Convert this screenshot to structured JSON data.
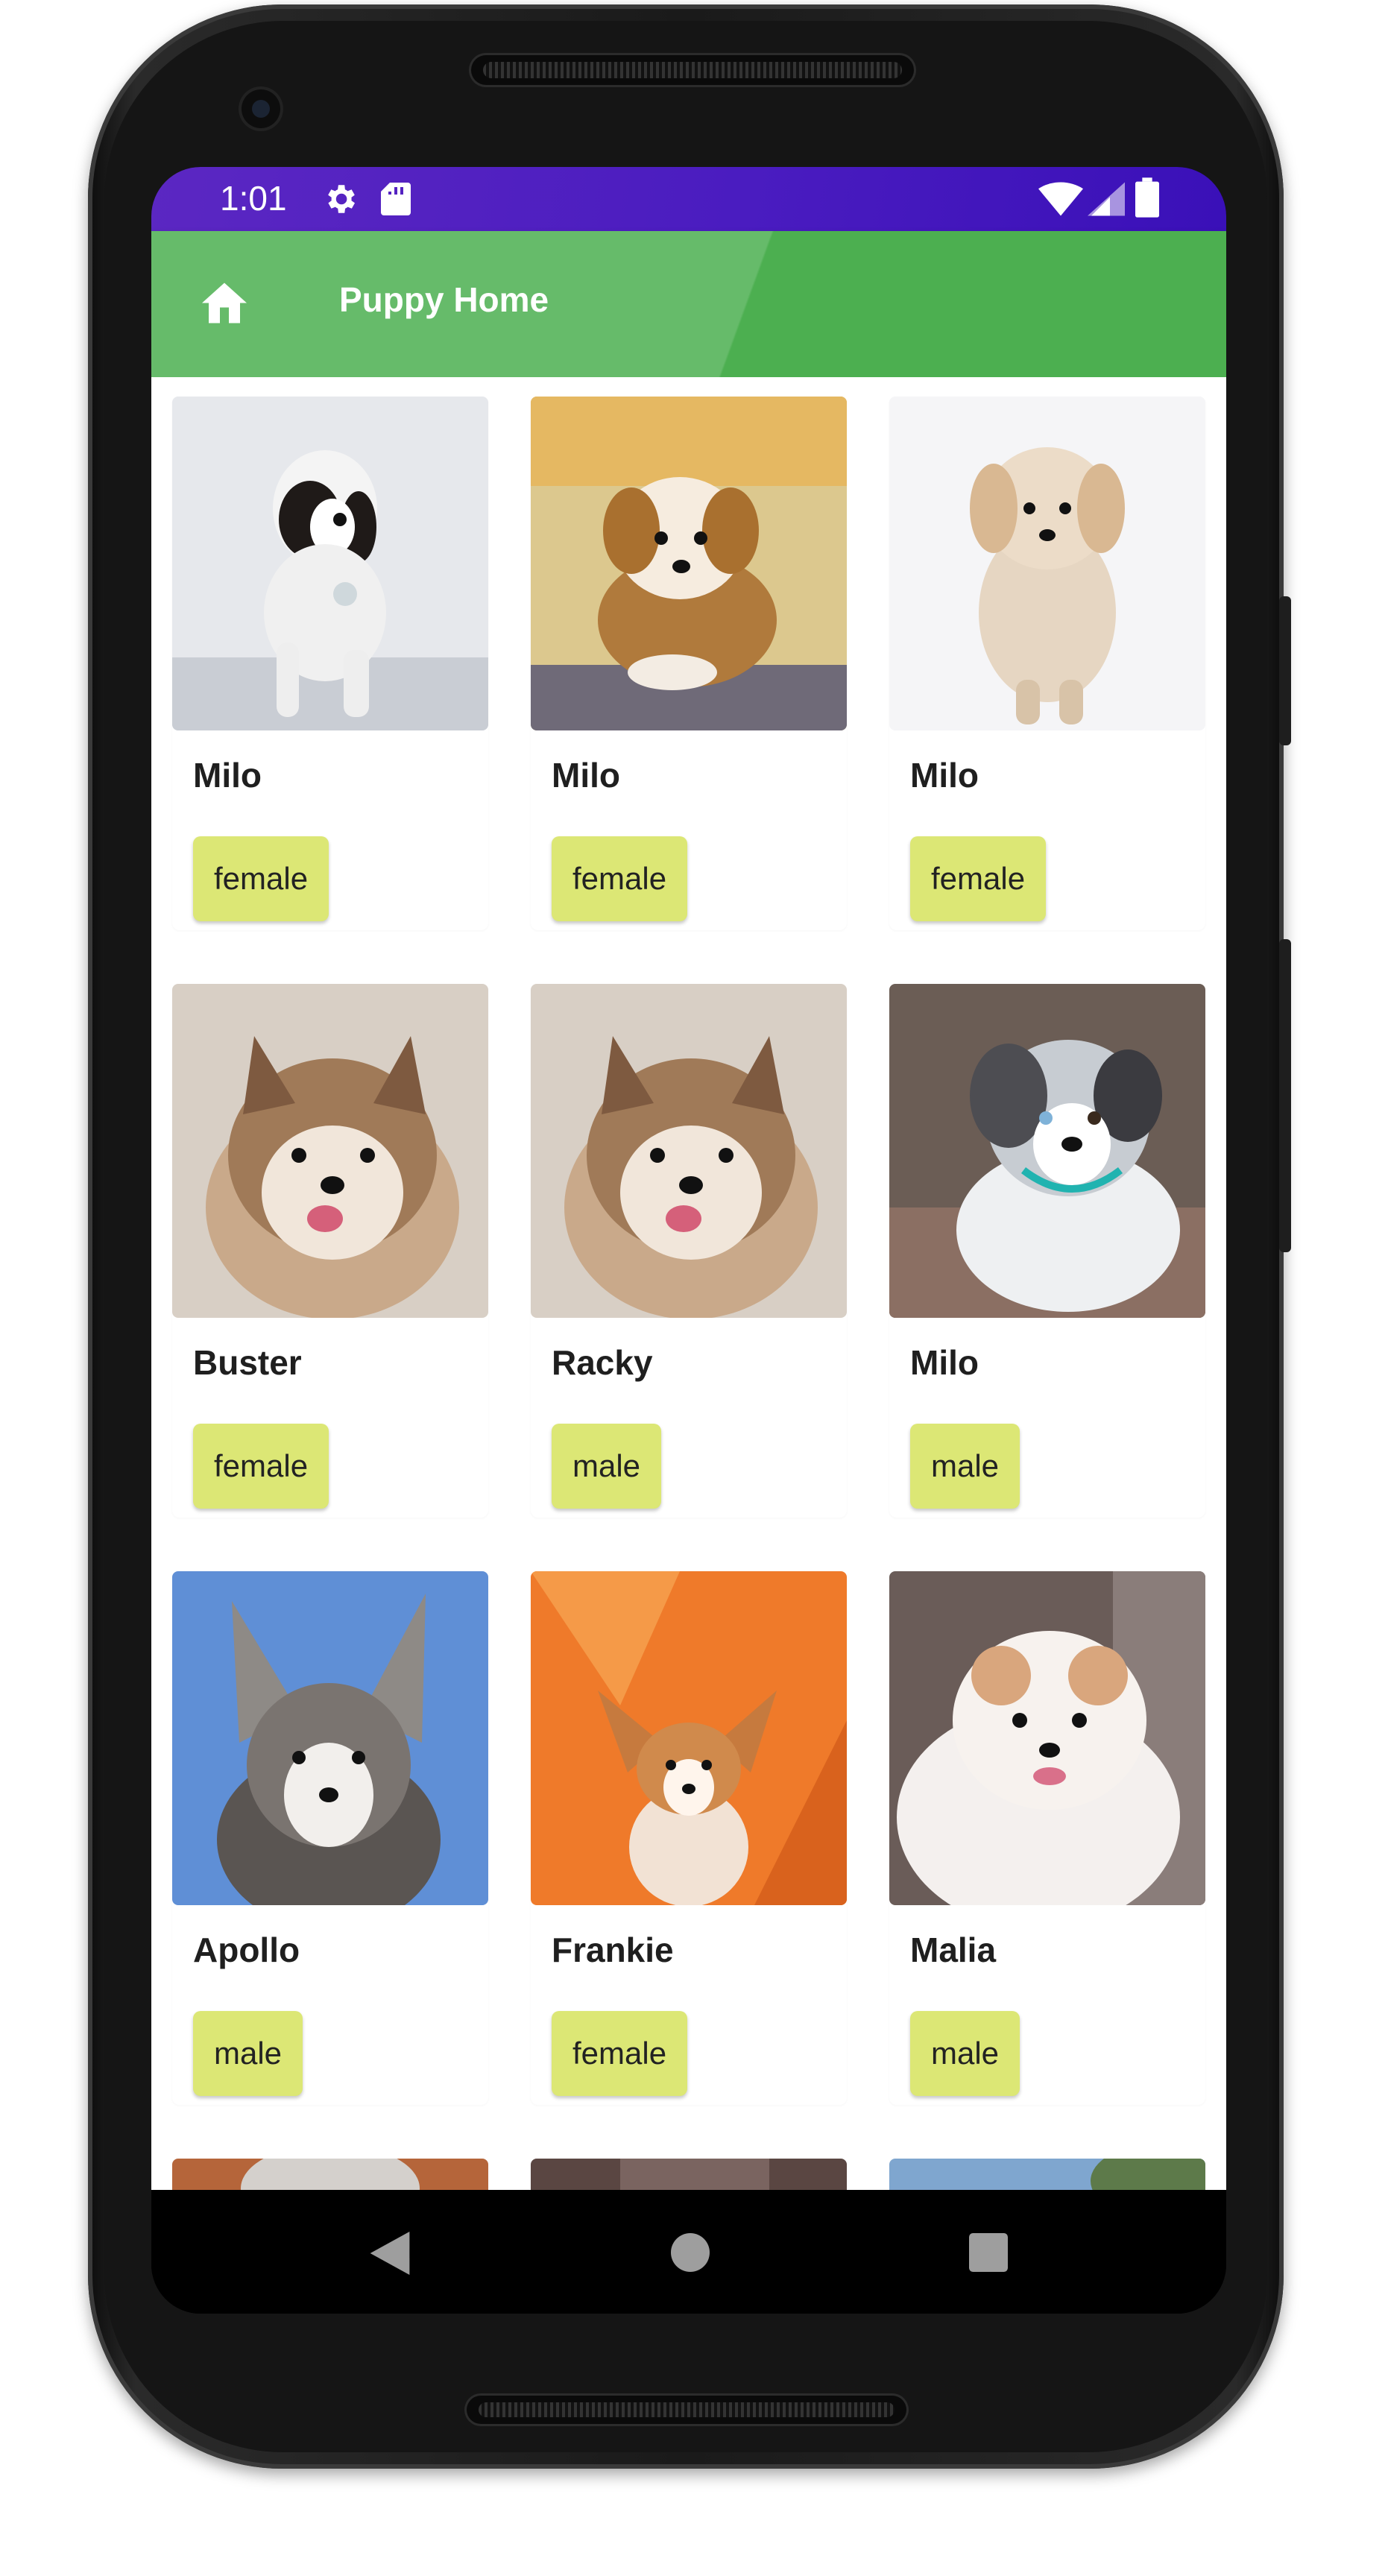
{
  "status_bar": {
    "time": "1:01",
    "icons": [
      "gear-icon",
      "sd-card-icon",
      "wifi-icon",
      "signal-icon",
      "battery-icon"
    ]
  },
  "app_bar": {
    "title": "Puppy Home",
    "icon": "home-icon"
  },
  "puppies": [
    {
      "name": "Milo",
      "gender": "female"
    },
    {
      "name": "Milo",
      "gender": "female"
    },
    {
      "name": "Milo",
      "gender": "female"
    },
    {
      "name": "Buster",
      "gender": "female"
    },
    {
      "name": "Racky",
      "gender": "male"
    },
    {
      "name": "Milo",
      "gender": "male"
    },
    {
      "name": "Apollo",
      "gender": "male"
    },
    {
      "name": "Frankie",
      "gender": "female"
    },
    {
      "name": "Malia",
      "gender": "male"
    }
  ],
  "nav_bar": {
    "icons": [
      "back-icon",
      "home-circle-icon",
      "recents-icon"
    ]
  },
  "colors": {
    "status_bar": "#4a1cc0",
    "app_bar": "#4caf50",
    "chip": "#dce775"
  }
}
